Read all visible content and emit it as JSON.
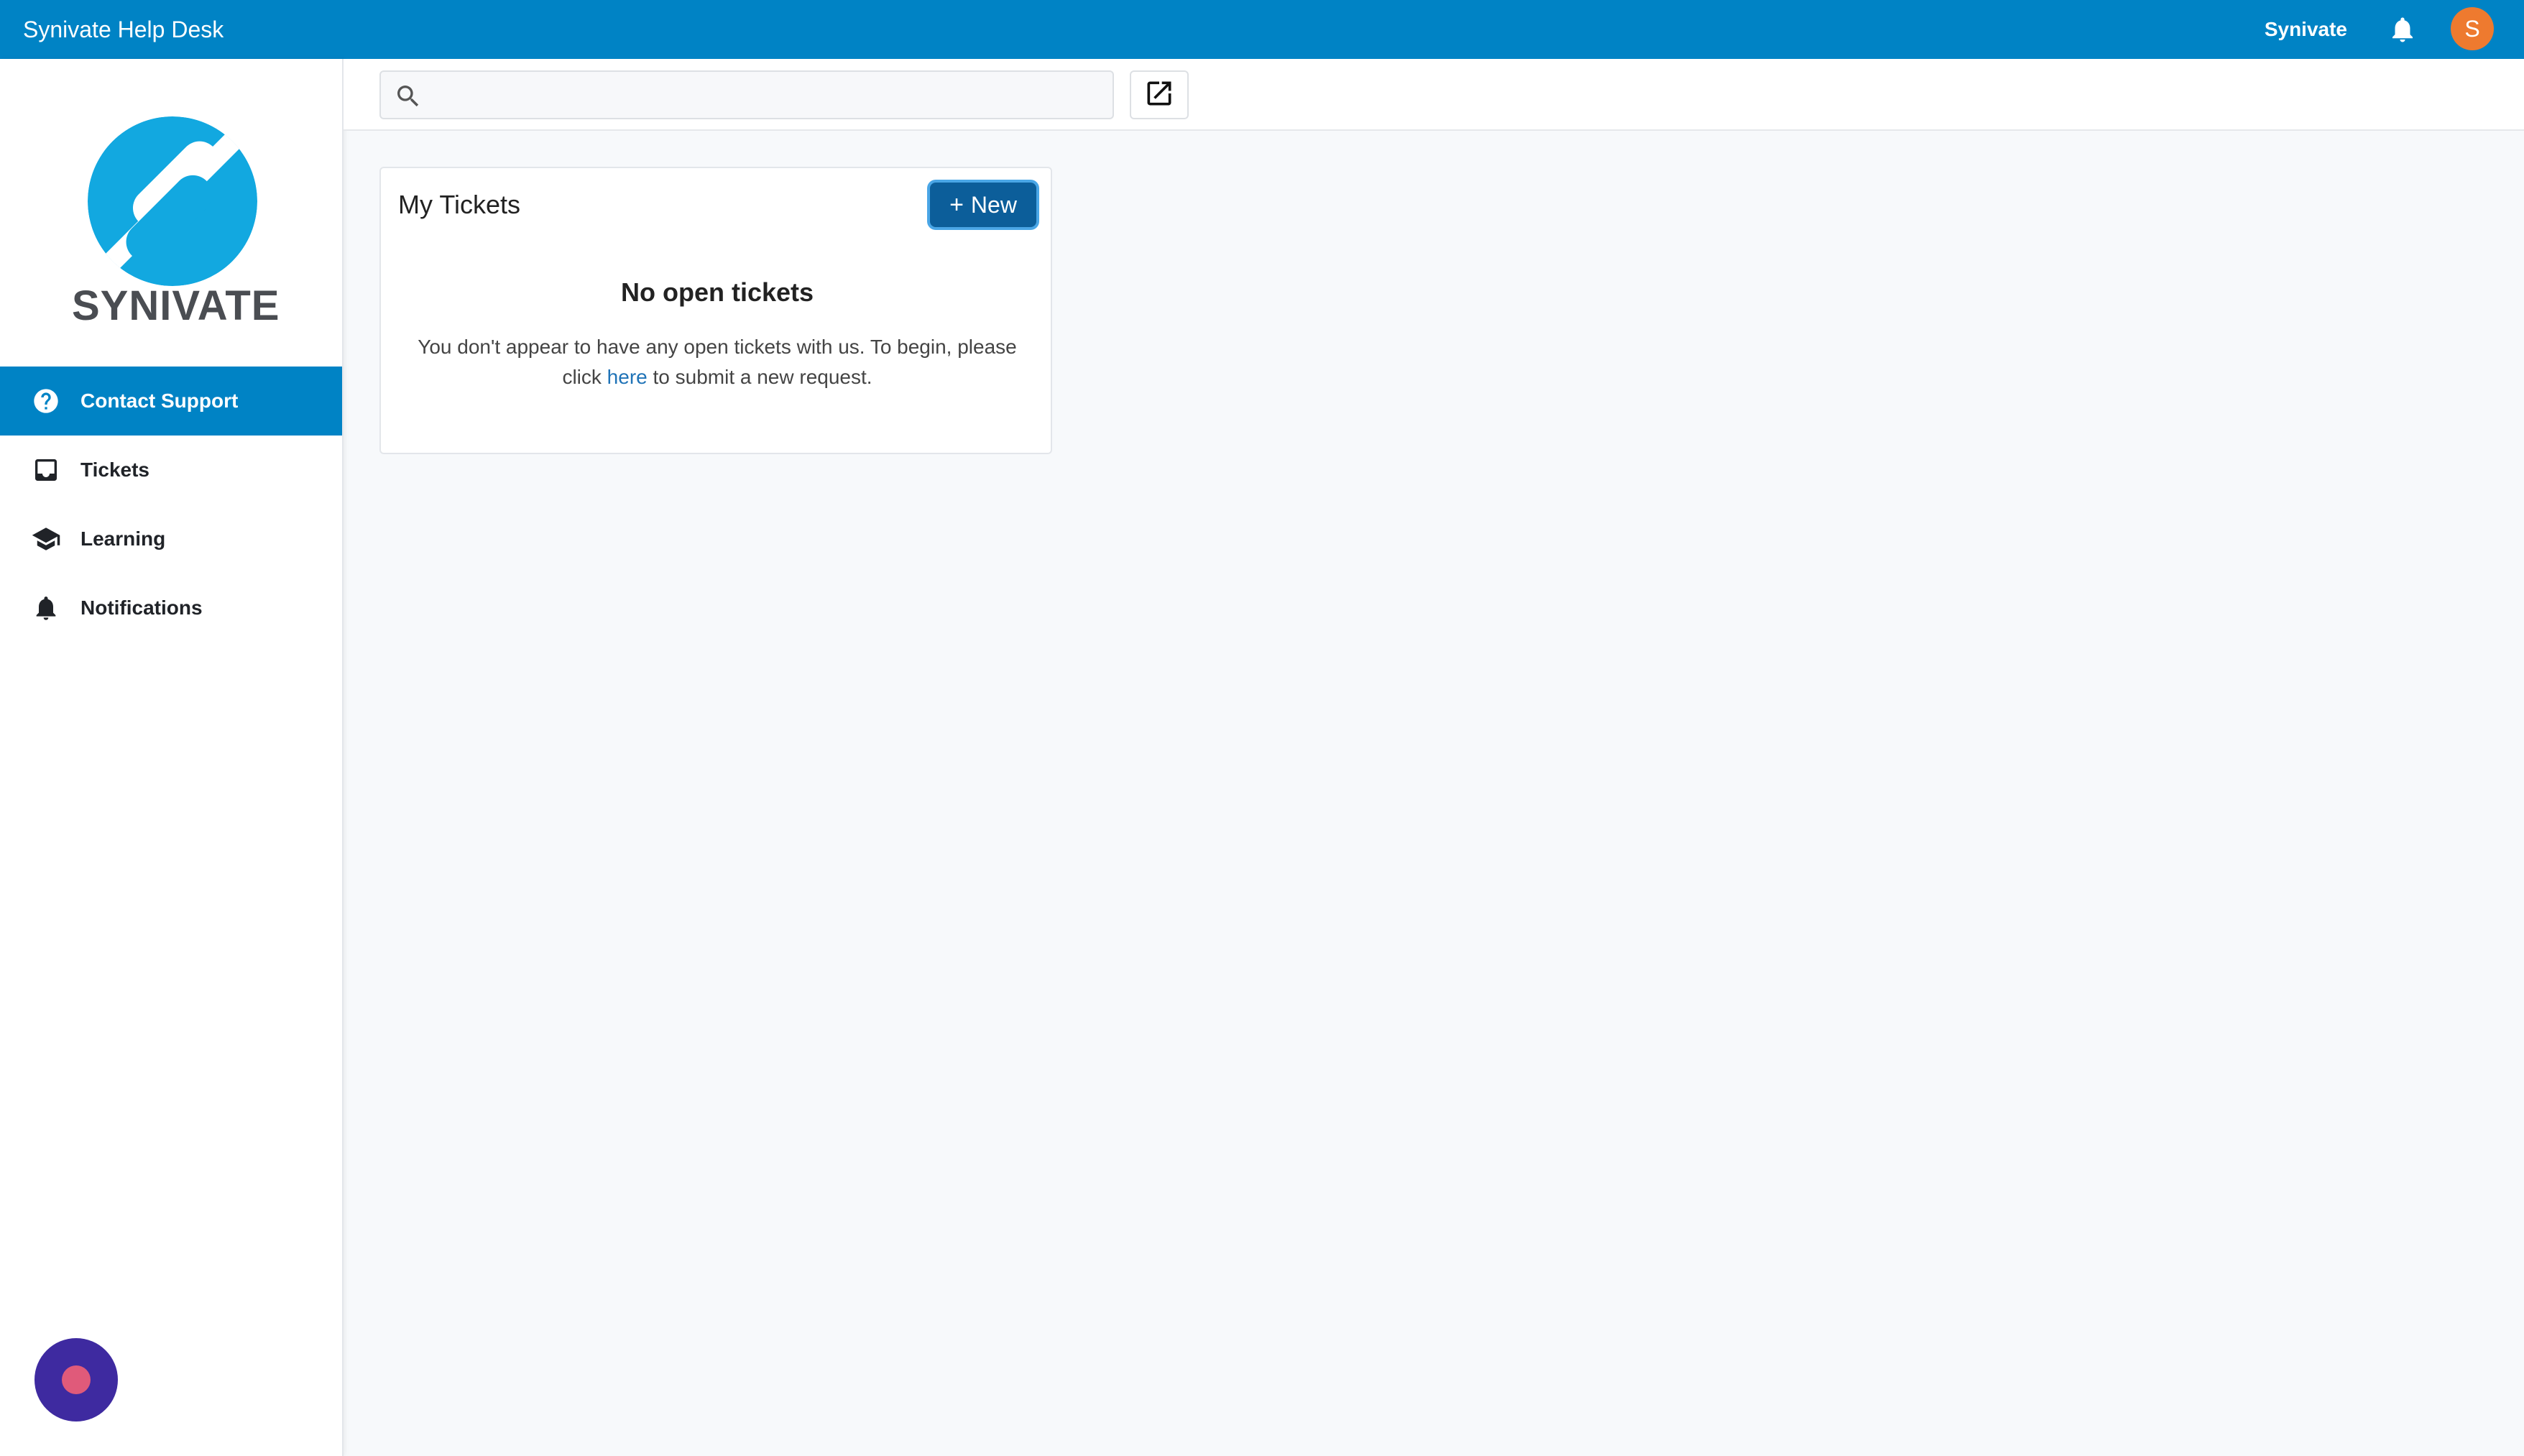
{
  "topbar": {
    "app_title": "Synivate Help Desk",
    "user_name": "Synivate",
    "avatar_letter": "S",
    "bell_icon": "bell-icon"
  },
  "sidebar": {
    "logo_text": "SYNIVATE",
    "items": [
      {
        "label": "Contact Support",
        "icon": "help-circle-icon",
        "active": true
      },
      {
        "label": "Tickets",
        "icon": "inbox-icon",
        "active": false
      },
      {
        "label": "Learning",
        "icon": "graduation-cap-icon",
        "active": false
      },
      {
        "label": "Notifications",
        "icon": "bell-icon",
        "active": false
      }
    ]
  },
  "toolbar": {
    "search_value": "",
    "search_placeholder": "",
    "search_icon": "search-icon",
    "external_icon": "open-in-new-icon"
  },
  "tickets_card": {
    "title": "My Tickets",
    "new_button_label": "New",
    "empty_title": "No open tickets",
    "empty_message_before": "You don't appear to have any open tickets with us. To begin, please click",
    "empty_message_link": "here",
    "empty_message_after": "to submit a new request."
  },
  "colors": {
    "brand_blue": "#0083c5",
    "button_blue": "#0c5e9a",
    "avatar_orange": "#ee7a2f",
    "widget_purple": "#3e2aa0"
  }
}
